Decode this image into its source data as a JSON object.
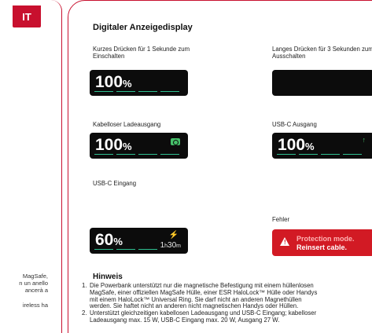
{
  "left_page": {
    "lang_tab": "IT",
    "text_lines": [
      "MagSafe,",
      "n un anello",
      "ancerà a",
      "ireless ha"
    ]
  },
  "main": {
    "title": "Digitaler Anzeigedisplay",
    "cards": [
      {
        "caption_line1": "Kurzes Drücken für 1 Sekunde zum",
        "caption_line2": "Einschalten",
        "value": "100",
        "unit": "%"
      },
      {
        "caption_line1": "Langes Drücken für 3 Sekunden zum",
        "caption_line2": "Ausschalten",
        "value": "",
        "unit": ""
      },
      {
        "caption_line1": "Kabelloser Ladeausgang",
        "caption_line2": "",
        "value": "100",
        "unit": "%",
        "icon": "wireless-charging-icon"
      },
      {
        "caption_line1": "USB-C Ausgang",
        "caption_line2": "",
        "value": "100",
        "unit": "%",
        "icon": "arrow-up-icon",
        "icon_glyph": "↑"
      },
      {
        "caption_line1": "USB-C Eingang",
        "caption_line2": "",
        "value": "60",
        "unit": "%",
        "icon": "lightning-icon",
        "icon_glyph": "⚡",
        "time_h": "1",
        "time_h_unit": "h",
        "time_m": "30",
        "time_m_unit": "m"
      },
      {
        "caption_line1": "Fehler",
        "caption_line2": "",
        "error_line1": "Protection mode.",
        "error_line2": "Reinsert cable.",
        "warn_glyph": "!"
      }
    ],
    "hint_title": "Hinweis",
    "notes": [
      {
        "num": "1.",
        "lines": [
          "Die Powerbank unterstützt nur die magnetische Befestigung mit einem hüllenlosen",
          "MagSafe, einer offiziellen MagSafe Hülle, einer ESR HaloLock™ Hülle oder Handys",
          "mit einem HaloLock™ Universal Ring. Sie darf nicht an anderen Magnethüllen",
          "werden. Sie haftet nicht an anderen nicht magnetischen Handys oder Hüllen."
        ]
      },
      {
        "num": "2.",
        "lines": [
          "Unterstützt gleichzeitigen kabellosen Ladeausgang und USB-C Eingang; kabelloser",
          "Ladeausgang max. 15 W, USB-C Eingang max. 20 W, Ausgang 27 W."
        ]
      }
    ]
  },
  "colors": {
    "accent": "#c8102e",
    "display_bg": "#0c0c0c",
    "segment": "#2fbf91",
    "icon_green": "#46c06a",
    "error_bg": "#d21a24"
  }
}
